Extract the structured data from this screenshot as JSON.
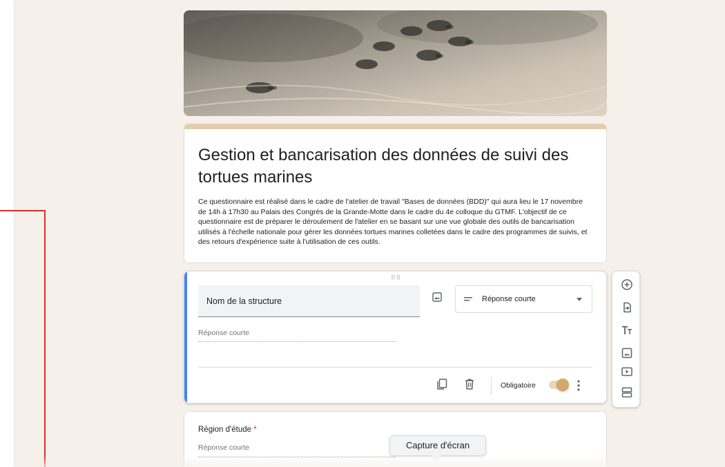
{
  "form": {
    "title": "Gestion et bancarisation des données de suivi des tortues marines",
    "description": "Ce questionnaire est réalisé dans le cadre de l'atelier de travail \"Bases de données (BDD)\" qui aura lieu le 17 novembre de 14h à 17h30 au Palais des Congrès de la Grande-Motte dans le cadre du 4e colloque du GTMF. L'objectif de ce questionnaire est de préparer le déroulement de l'atelier en se basant sur une vue globale des outils de bancarisation utilisés à l'échelle nationale pour gérer les données tortues marines colletées dans le cadre des programmes de suivis, et des retours d'expérience suite à l'utilisation de ces outils."
  },
  "question1": {
    "title": "Nom de la structure",
    "type_label": "Réponse courte",
    "answer_placeholder": "Réponse courte",
    "required_label": "Obligatoire",
    "required": true
  },
  "question2": {
    "title": "Région d'étude",
    "required_mark": "*",
    "answer_placeholder": "Réponse courte"
  },
  "tooltip": {
    "text": "Capture d'écran"
  },
  "icons": {
    "header_image": "sea-turtle-hatchlings-on-sand",
    "toolbar": [
      "add-question-icon",
      "import-questions-icon",
      "add-title-icon",
      "add-image-icon",
      "add-video-icon",
      "add-section-icon"
    ],
    "footer": [
      "duplicate-icon",
      "delete-icon",
      "more-vert-icon"
    ]
  },
  "colors": {
    "accent": "#4285f4",
    "theme": "#e3cdb0",
    "toggle": "#d3a96c",
    "required_star": "#d93025",
    "background": "#f5f0ea"
  }
}
